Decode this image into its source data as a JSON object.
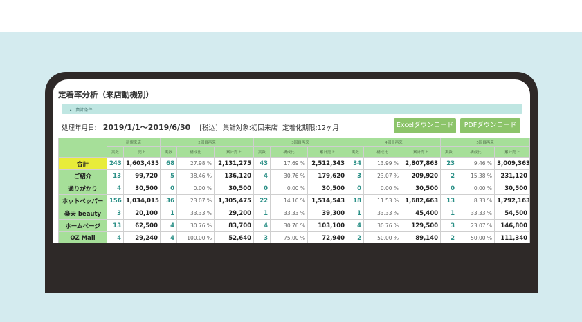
{
  "page": {
    "title": "定着率分析（来店動機別）",
    "condition_label": "集計条件",
    "period_label": "処理年月日:",
    "period_value": "2019/1/1〜2019/6/30",
    "tax_label": "[税込]",
    "target_label": "集計対象:初回来店",
    "term_label": "定着化期限:12ヶ月"
  },
  "buttons": {
    "excel": "Excelダウンロード",
    "pdf": "PDFダウンロード"
  },
  "table": {
    "group_headers": [
      "新規来店",
      "2回目再来",
      "3回目再来",
      "4回目再来",
      "5回目再来"
    ],
    "sub_headers": {
      "count": "実数",
      "sales": "売上",
      "ratio": "構成比",
      "cum_sales": "累計売上"
    },
    "rows": [
      {
        "label": "合計",
        "new_count": "243",
        "new_sales": "1,603,435",
        "c2": "68",
        "r2": "27.98 %",
        "s2": "2,131,275",
        "c3": "43",
        "r3": "17.69 %",
        "s3": "2,512,343",
        "c4": "34",
        "r4": "13.99 %",
        "s4": "2,807,863",
        "c5": "23",
        "r5": "9.46 %",
        "s5": "3,009,363"
      },
      {
        "label": "ご紹介",
        "new_count": "13",
        "new_sales": "99,720",
        "c2": "5",
        "r2": "38.46 %",
        "s2": "136,120",
        "c3": "4",
        "r3": "30.76 %",
        "s3": "179,620",
        "c4": "3",
        "r4": "23.07 %",
        "s4": "209,920",
        "c5": "2",
        "r5": "15.38 %",
        "s5": "231,120"
      },
      {
        "label": "通りがかり",
        "new_count": "4",
        "new_sales": "30,500",
        "c2": "0",
        "r2": "0.00 %",
        "s2": "30,500",
        "c3": "0",
        "r3": "0.00 %",
        "s3": "30,500",
        "c4": "0",
        "r4": "0.00 %",
        "s4": "30,500",
        "c5": "0",
        "r5": "0.00 %",
        "s5": "30,500"
      },
      {
        "label": "ホットペッパー",
        "new_count": "156",
        "new_sales": "1,034,015",
        "c2": "36",
        "r2": "23.07 %",
        "s2": "1,305,475",
        "c3": "22",
        "r3": "14.10 %",
        "s3": "1,514,543",
        "c4": "18",
        "r4": "11.53 %",
        "s4": "1,682,663",
        "c5": "13",
        "r5": "8.33 %",
        "s5": "1,792,163"
      },
      {
        "label": "楽天 beauty",
        "new_count": "3",
        "new_sales": "20,100",
        "c2": "1",
        "r2": "33.33 %",
        "s2": "29,200",
        "c3": "1",
        "r3": "33.33 %",
        "s3": "39,300",
        "c4": "1",
        "r4": "33.33 %",
        "s4": "45,400",
        "c5": "1",
        "r5": "33.33 %",
        "s5": "54,500"
      },
      {
        "label": "ホームページ",
        "new_count": "13",
        "new_sales": "62,500",
        "c2": "4",
        "r2": "30.76 %",
        "s2": "83,700",
        "c3": "4",
        "r3": "30.76 %",
        "s3": "103,100",
        "c4": "4",
        "r4": "30.76 %",
        "s4": "129,500",
        "c5": "3",
        "r5": "23.07 %",
        "s5": "146,800"
      },
      {
        "label": "OZ Mall",
        "new_count": "4",
        "new_sales": "29,240",
        "c2": "4",
        "r2": "100.00 %",
        "s2": "52,640",
        "c3": "3",
        "r3": "75.00 %",
        "s3": "72,940",
        "c4": "2",
        "r4": "50.00 %",
        "s4": "89,140",
        "c5": "2",
        "r5": "50.00 %",
        "s5": "111,340"
      }
    ]
  },
  "colors": {
    "background": "#d4ebef",
    "device_frame": "#2e2928",
    "header_green": "#a6df99",
    "total_yellow": "#e8ec3a",
    "button_green": "#8cc46a",
    "count_teal": "#2a8f86",
    "condition_bar": "#bfe6e2"
  }
}
